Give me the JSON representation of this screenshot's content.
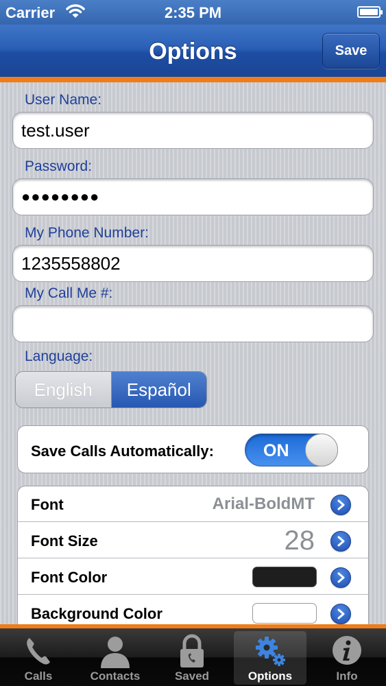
{
  "status_bar": {
    "carrier": "Carrier",
    "time": "2:35 PM"
  },
  "nav": {
    "title": "Options",
    "save_label": "Save"
  },
  "form": {
    "username_label": "User Name:",
    "username_value": "test.user",
    "password_label": "Password:",
    "password_value": "●●●●●●●●",
    "phone_label": "My Phone Number:",
    "phone_value": "1235558802",
    "callme_label": "My Call Me #:",
    "callme_value": "",
    "language_label": "Language:",
    "languages": [
      "English",
      "Español"
    ],
    "language_selected": "Español"
  },
  "autosave": {
    "label": "Save Calls Automatically:",
    "state": "ON"
  },
  "settings": [
    {
      "name": "Font",
      "value": "Arial-BoldMT"
    },
    {
      "name": "Font Size",
      "value": "28"
    },
    {
      "name": "Font Color",
      "swatch": "#1e1e1e"
    },
    {
      "name": "Background Color",
      "swatch": "#ffffff"
    }
  ],
  "tabs": [
    {
      "label": "Calls",
      "icon": "phone-icon"
    },
    {
      "label": "Contacts",
      "icon": "person-icon"
    },
    {
      "label": "Saved",
      "icon": "lock-icon"
    },
    {
      "label": "Options",
      "icon": "gears-icon",
      "active": true
    },
    {
      "label": "Info",
      "icon": "info-icon"
    }
  ],
  "colors": {
    "nav_blue": "#2a5fb6",
    "accent_orange": "#f07d17",
    "label_blue": "#20409a",
    "toggle_blue": "#1c6ad7"
  }
}
